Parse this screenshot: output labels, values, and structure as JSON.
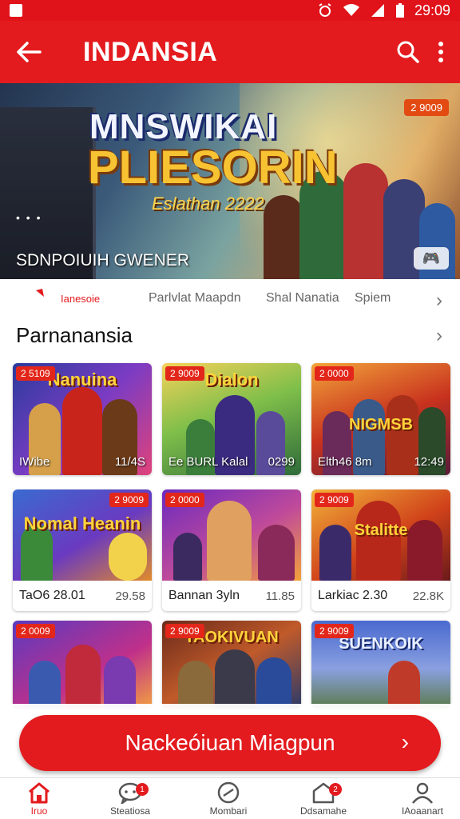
{
  "status_bar": {
    "time": "29:09"
  },
  "app_bar": {
    "title": "INDANSIA"
  },
  "banner": {
    "logo_line1": "MNSWIKAI",
    "logo_line2": "PLIESORIN",
    "logo_line3": "Eslathan 2222",
    "subtitle": "SDNPOIUIH GWENER",
    "badge": "2 9009"
  },
  "tabs": [
    {
      "label": "Ianesoie",
      "active": true
    },
    {
      "label": "Parlvlat Maapdn",
      "active": false
    },
    {
      "label": "Shal Nanatia",
      "active": false
    },
    {
      "label": "Spiem",
      "active": false
    }
  ],
  "section": {
    "title": "Parnanansia"
  },
  "cards": [
    {
      "tag": "2 5109",
      "art_title": "Nanuina",
      "left": "IWibe",
      "right": "11/4S",
      "style": "overlay"
    },
    {
      "tag": "2 9009",
      "art_title": "Dialon",
      "left": "Ee BURL Kalal",
      "right": "0299",
      "style": "overlay"
    },
    {
      "tag": "2 0000",
      "art_title": "NIGMSB",
      "left": "Elth46 8m",
      "right": "12:49",
      "style": "overlay"
    },
    {
      "tag": "2 9009",
      "art_title": "Nomal Heanin",
      "left": "TaO6 28.01",
      "right": "29.58",
      "style": "below"
    },
    {
      "tag": "2 0000",
      "art_title": "",
      "left": "Bannan 3yln",
      "right": "11.85",
      "style": "below"
    },
    {
      "tag": "2 9009",
      "art_title": "Stalitte",
      "left": "Larkiac 2.30",
      "right": "22.8K",
      "style": "below"
    },
    {
      "tag": "2 0009",
      "art_title": "",
      "left": "",
      "right": "",
      "style": "partial"
    },
    {
      "tag": "2 9009",
      "art_title": "TAOKIVUAN",
      "left": "",
      "right": "",
      "style": "partial"
    },
    {
      "tag": "2 9009",
      "art_title": "SUENKOIK",
      "left": "",
      "right": "",
      "style": "partial"
    }
  ],
  "cta": {
    "label": "Nackeóiuan Miagpun"
  },
  "bottom_nav": [
    {
      "label": "Iruo",
      "icon": "home-icon",
      "badge": "",
      "active": true
    },
    {
      "label": "Steatiosa",
      "icon": "chat-icon",
      "badge": "1",
      "active": false
    },
    {
      "label": "Mombari",
      "icon": "compass-icon",
      "badge": "",
      "active": false
    },
    {
      "label": "Ddsamahe",
      "icon": "box-icon",
      "badge": "2",
      "active": false
    },
    {
      "label": "IAoaanart",
      "icon": "profile-icon",
      "badge": "",
      "active": false
    }
  ],
  "colors": {
    "brand_red": "#e31b1e",
    "tag_red": "#e3261a",
    "gold": "#ffd43b"
  }
}
